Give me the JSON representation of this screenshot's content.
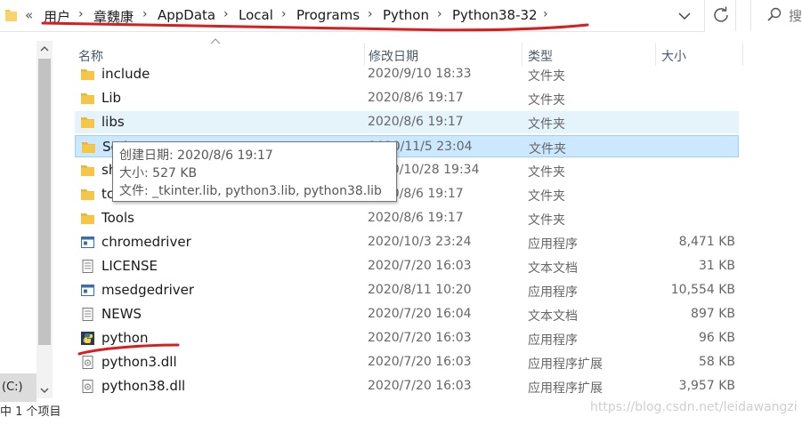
{
  "address_bar": {
    "prefix": "«",
    "crumbs": [
      "用户",
      "章魏康",
      "AppData",
      "Local",
      "Programs",
      "Python",
      "Python38-32"
    ],
    "separator": "›",
    "dropdown_icon": "chevron-down-icon",
    "refresh_icon": "refresh-icon"
  },
  "search": {
    "placeholder": "搜",
    "icon": "search-icon"
  },
  "columns": {
    "name": "名称",
    "date": "修改日期",
    "type": "类型",
    "size": "大小"
  },
  "files": [
    {
      "name": "include",
      "date": "2020/9/10 18:33",
      "type": "文件夹",
      "size": "",
      "icon": "folder-icon"
    },
    {
      "name": "Lib",
      "date": "2020/8/6 19:17",
      "type": "文件夹",
      "size": "",
      "icon": "folder-icon"
    },
    {
      "name": "libs",
      "date": "2020/8/6 19:17",
      "type": "文件夹",
      "size": "",
      "icon": "folder-icon",
      "state": "hover"
    },
    {
      "name": "Scripts",
      "date": "2020/11/5 23:04",
      "type": "文件夹",
      "size": "",
      "icon": "folder-icon",
      "state": "selected"
    },
    {
      "name": "share",
      "date": "2020/10/28 19:34",
      "type": "文件夹",
      "size": "",
      "icon": "folder-icon"
    },
    {
      "name": "tcl",
      "date": "2020/8/6 19:17",
      "type": "文件夹",
      "size": "",
      "icon": "folder-icon"
    },
    {
      "name": "Tools",
      "date": "2020/8/6 19:17",
      "type": "文件夹",
      "size": "",
      "icon": "folder-icon"
    },
    {
      "name": "chromedriver",
      "date": "2020/10/3 23:24",
      "type": "应用程序",
      "size": "8,471 KB",
      "icon": "exe-icon"
    },
    {
      "name": "LICENSE",
      "date": "2020/7/20 16:03",
      "type": "文本文档",
      "size": "31 KB",
      "icon": "text-file-icon"
    },
    {
      "name": "msedgedriver",
      "date": "2020/8/11 10:20",
      "type": "应用程序",
      "size": "10,554 KB",
      "icon": "exe-icon"
    },
    {
      "name": "NEWS",
      "date": "2020/7/20 16:04",
      "type": "文本文档",
      "size": "897 KB",
      "icon": "text-file-icon"
    },
    {
      "name": "python",
      "date": "2020/7/20 16:03",
      "type": "应用程序",
      "size": "96 KB",
      "icon": "python-icon"
    },
    {
      "name": "python3.dll",
      "date": "2020/7/20 16:03",
      "type": "应用程序扩展",
      "size": "58 KB",
      "icon": "dll-icon"
    },
    {
      "name": "python38.dll",
      "date": "2020/7/20 16:03",
      "type": "应用程序扩展",
      "size": "3,957 KB",
      "icon": "dll-icon"
    }
  ],
  "tooltip": {
    "created": "创建日期: 2020/8/6 19:17",
    "size": "大小: 527 KB",
    "files": "文件: _tkinter.lib, python3.lib, python38.lib"
  },
  "nav": {
    "drive": "(C:)"
  },
  "status": {
    "text": "中 1 个项目"
  },
  "watermark": "https://blog.csdn.net/leidawangzi",
  "colors": {
    "hover_bg": "#e5f3fb",
    "selected_bg": "#cce8ff",
    "selected_border": "#99d1ff",
    "folder": "#f6c649",
    "annotation": "#d81e1e"
  }
}
